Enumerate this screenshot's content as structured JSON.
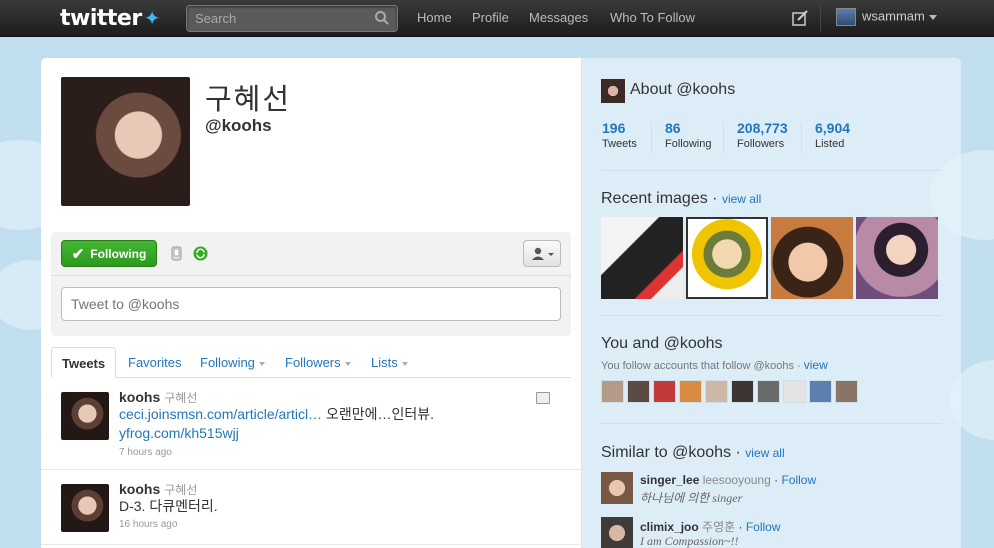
{
  "topbar": {
    "logo": "twitter",
    "search_placeholder": "Search",
    "nav": [
      "Home",
      "Profile",
      "Messages",
      "Who To Follow"
    ],
    "username": "wsammam"
  },
  "profile": {
    "name": "구혜선",
    "handle": "@koohs",
    "follow_label": "Following",
    "tweet_placeholder": "Tweet to @koohs"
  },
  "tabs": [
    "Tweets",
    "Favorites",
    "Following",
    "Followers",
    "Lists"
  ],
  "tweets": [
    {
      "user": "koohs",
      "fullname": "구혜선",
      "link1": "ceci.joinsmsn.com/article/articl…",
      "text1": " 오랜만에…인터뷰.",
      "link2": "yfrog.com/kh515wjj",
      "time": "7 hours ago"
    },
    {
      "user": "koohs",
      "fullname": "구혜선",
      "text": "D-3. 다큐멘터리.",
      "time": "16 hours ago"
    }
  ],
  "sidebar": {
    "about": "About @koohs",
    "stats": [
      {
        "value": "196",
        "label": "Tweets"
      },
      {
        "value": "86",
        "label": "Following"
      },
      {
        "value": "208,773",
        "label": "Followers"
      },
      {
        "value": "6,904",
        "label": "Listed"
      }
    ],
    "recent_images": "Recent images",
    "view_all": "view all",
    "you_and": "You and @koohs",
    "you_follow": "You follow accounts that follow @koohs · ",
    "view": "view",
    "similar": "Similar to @koohs",
    "similar_view_all": "view all",
    "similar_users": [
      {
        "name": "singer_lee",
        "screen": "leesooyoung",
        "follow": "Follow",
        "desc": "하나님에 의한 singer"
      },
      {
        "name": "climix_joo",
        "screen": "주영훈",
        "follow": "Follow",
        "desc": "I am Compassion~!!"
      }
    ]
  },
  "colors": {
    "accent": "#2276bb",
    "follow_green": "#36a826",
    "topbar": "#2a2a2a",
    "background": "#c0deed"
  }
}
